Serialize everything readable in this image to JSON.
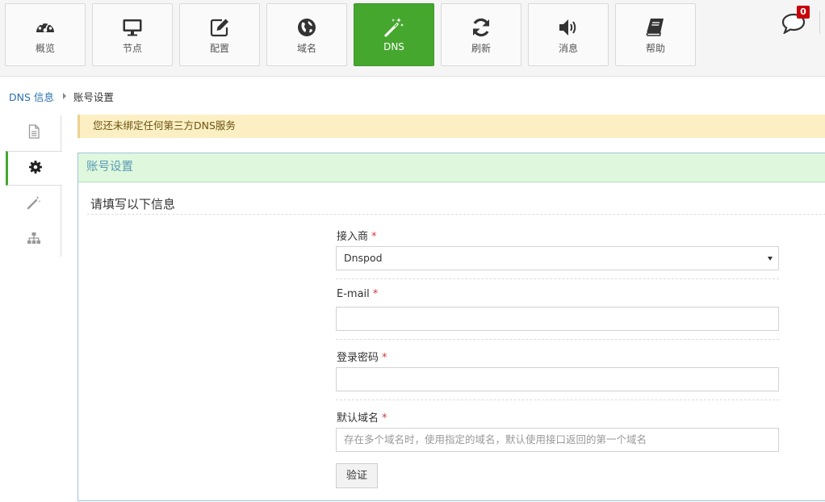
{
  "nav": {
    "items": [
      {
        "label": "概览",
        "icon": "dashboard-icon"
      },
      {
        "label": "节点",
        "icon": "monitor-icon"
      },
      {
        "label": "配置",
        "icon": "edit-icon"
      },
      {
        "label": "域名",
        "icon": "globe-icon"
      },
      {
        "label": "DNS",
        "icon": "magic-wand-icon",
        "active": true
      },
      {
        "label": "刷新",
        "icon": "refresh-icon"
      },
      {
        "label": "消息",
        "icon": "volume-icon"
      },
      {
        "label": "帮助",
        "icon": "book-icon"
      }
    ],
    "active_color": "#46a72f"
  },
  "notifications": {
    "count": "0",
    "icon": "comment-icon",
    "badge_color": "#c9000c"
  },
  "breadcrumb": {
    "parent": "DNS 信息",
    "current": "账号设置"
  },
  "sidetabs": [
    {
      "icon": "file-icon"
    },
    {
      "icon": "gear-icon",
      "active": true
    },
    {
      "icon": "magic-wand-icon"
    },
    {
      "icon": "sitemap-icon"
    }
  ],
  "alert": {
    "text": "您还未绑定任何第三方DNS服务"
  },
  "panel": {
    "title": "账号设置",
    "section_title": "请填写以下信息",
    "form": {
      "provider": {
        "label": "接入商",
        "required": "*",
        "value": "Dnspod"
      },
      "email": {
        "label": "E-mail",
        "required": "*",
        "value": ""
      },
      "password": {
        "label": "登录密码",
        "required": "*",
        "value": ""
      },
      "domain": {
        "label": "默认域名",
        "required": "*",
        "placeholder": "存在多个域名时，使用指定的域名，默认使用接口返回的第一个域名"
      },
      "verify_label": "验证"
    }
  }
}
